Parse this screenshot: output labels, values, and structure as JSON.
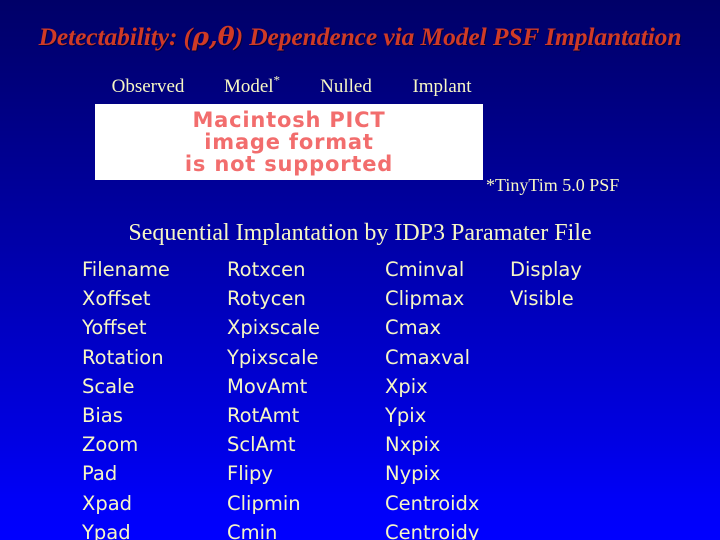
{
  "slide": {
    "title_prefix": "Detectability: (",
    "title_greek": "ρ,θ",
    "title_suffix": ") Dependence via Model PSF Implantation",
    "title_full": "Detectability: (ρ,θ) Dependence via Model PSF Implantation",
    "subtitle": "Sequential Implantation by IDP3 Paramater File",
    "footnote": "*TinyTim 5.0 PSF"
  },
  "colors": {
    "background_top": "#000068",
    "background_bottom": "#0000ff",
    "title_red": "#cf3a26",
    "text_yellow": "#f7f7c4",
    "pict_salmon": "#f26d6d",
    "pict_background": "#ffffff"
  },
  "image_headers": [
    {
      "label": "Observed",
      "sup": ""
    },
    {
      "label": "Model",
      "sup": "*"
    },
    {
      "label": "Nulled",
      "sup": ""
    },
    {
      "label": "Implant",
      "sup": ""
    }
  ],
  "pict_placeholder": {
    "line1": "Macintosh PICT",
    "line2": "image format",
    "line3": "is not supported"
  },
  "param_columns": [
    {
      "items": [
        "Filename",
        "Xoffset",
        "Yoffset",
        "Rotation",
        "Scale",
        "Bias",
        "Zoom",
        "Pad",
        "Xpad",
        "Ypad"
      ]
    },
    {
      "items": [
        "Rotxcen",
        "Rotycen",
        "Xpixscale",
        "Ypixscale",
        "MovAmt",
        "RotAmt",
        "SclAmt",
        "Flipy",
        "Clipmin",
        "Cmin"
      ]
    },
    {
      "items": [
        "Cminval",
        "Clipmax",
        "Cmax",
        "Cmaxval",
        "Xpix",
        "Ypix",
        "Nxpix",
        "Nypix",
        "Centroidx",
        "Centroidy"
      ]
    },
    {
      "items": [
        "Display",
        "Visible"
      ]
    }
  ]
}
